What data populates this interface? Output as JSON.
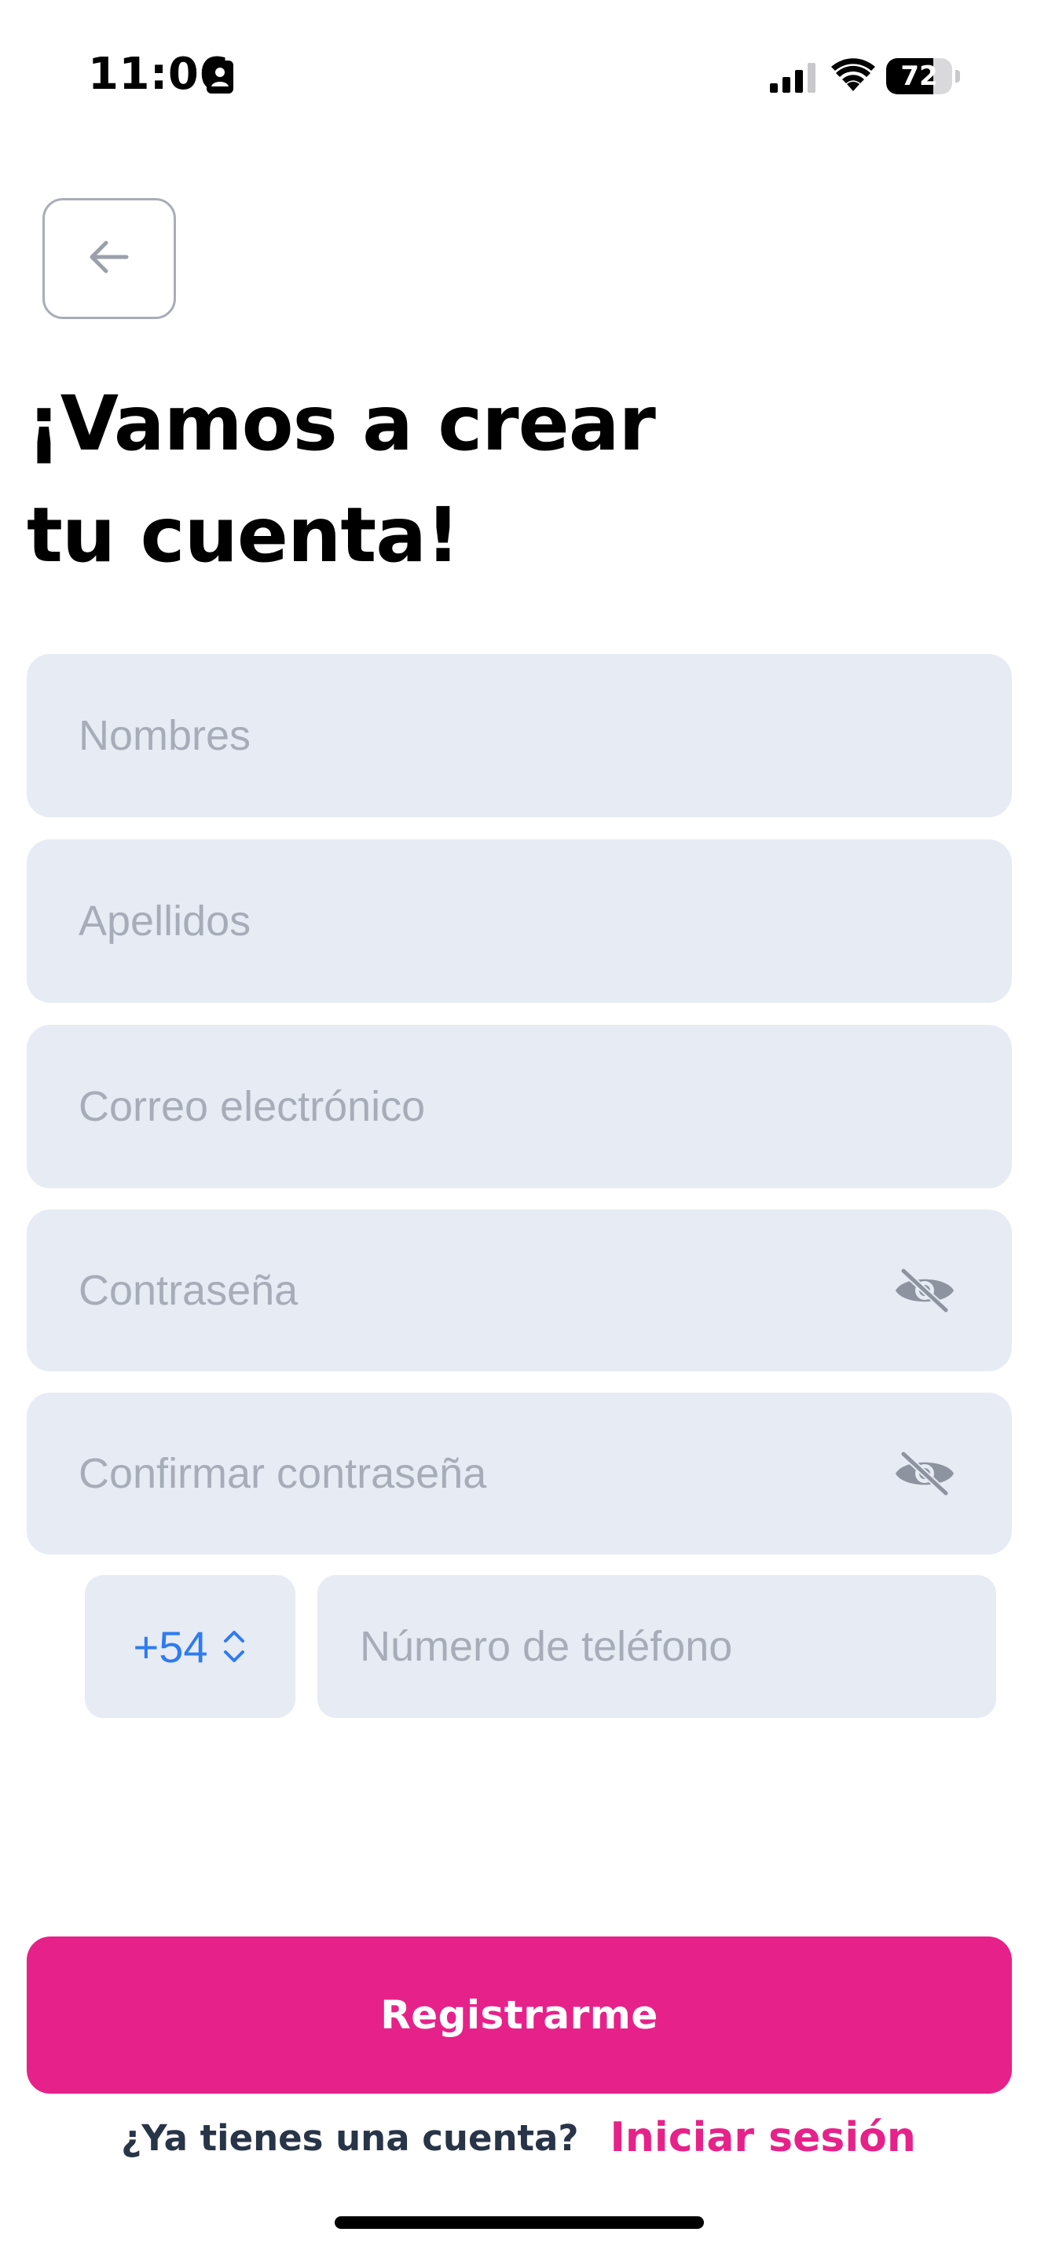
{
  "status_bar": {
    "time": "11:06",
    "battery_level": "72",
    "battery_fraction": 0.72
  },
  "header": {
    "title_line1": "¡Vamos a crear",
    "title_line2": "tu cuenta!"
  },
  "form": {
    "first_name_placeholder": "Nombres",
    "last_name_placeholder": "Apellidos",
    "email_placeholder": "Correo electrónico",
    "password_placeholder": "Contraseña",
    "confirm_password_placeholder": "Confirmar contraseña",
    "country_code": "+54",
    "phone_placeholder": "Número de teléfono"
  },
  "actions": {
    "register_label": "Registrarme",
    "login_question": "¿Ya tienes una cuenta?",
    "login_link": "Iniciar sesión"
  },
  "icons": {
    "back": "arrow-left-icon",
    "password_toggle": "eye-off-icon",
    "country_selector": "chevron-updown-icon",
    "status_id": "id-card-icon",
    "signal": "cellular-signal-icon",
    "wifi": "wifi-icon"
  },
  "colors": {
    "accent": "#e6228a",
    "field_background": "#e7ebf4",
    "placeholder": "#a7adb8",
    "country_code": "#2f7bf0",
    "login_question": "#283447"
  }
}
